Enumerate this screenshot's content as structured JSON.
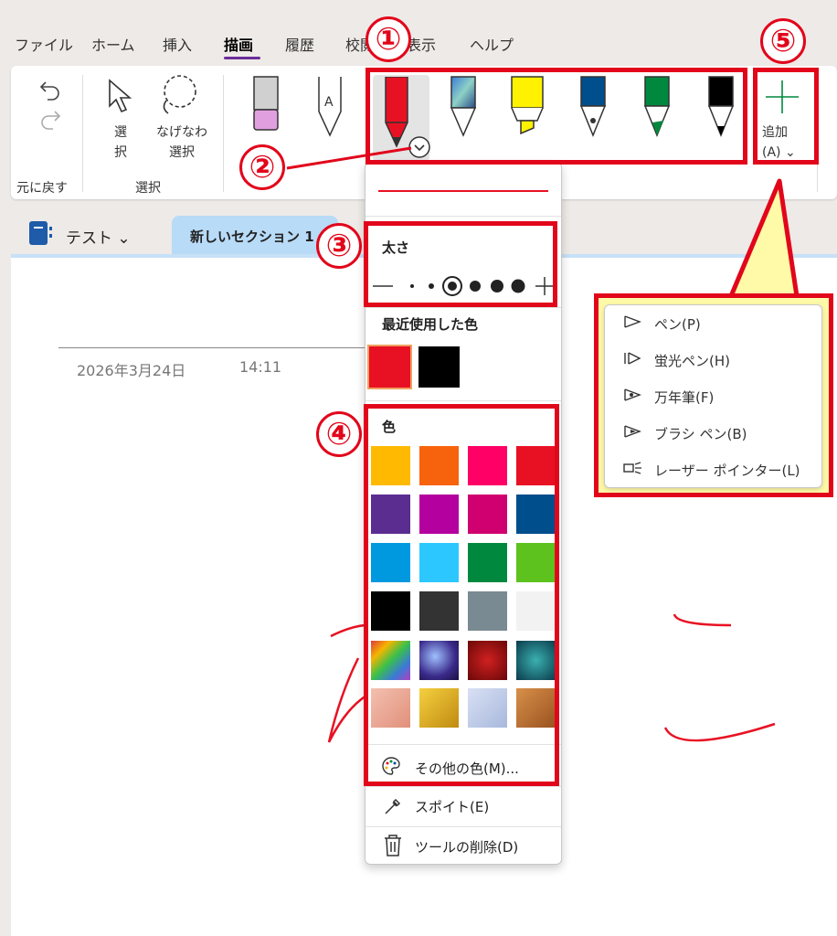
{
  "menu": {
    "items": [
      "ファイル",
      "ホーム",
      "挿入",
      "描画",
      "履歴",
      "校閲",
      "表示",
      "ヘルプ"
    ],
    "active": "描画"
  },
  "ribbon": {
    "undo_group_label": "元に戻す",
    "select_label": "選択",
    "select_button": "選\n択",
    "lasso_button": "なげなわ\n選択",
    "add_label": "追加",
    "add_shortcut": "(A)"
  },
  "notebook": {
    "name": "テスト",
    "section_tab": "新しいセクション 1"
  },
  "page": {
    "date": "2026年3月24日",
    "time": "14:11"
  },
  "flyout": {
    "thickness_label": "太さ",
    "recent_colors_label": "最近使用した色",
    "recent_colors": [
      "#e81123",
      "#000000"
    ],
    "colors_label": "色",
    "colors": [
      "#ffb900",
      "#f7630c",
      "#ff0066",
      "#e81123",
      "#5c2d91",
      "#b4009e",
      "#d00070",
      "#004e8c",
      "#0099e0",
      "#2dc7ff",
      "#00893e",
      "#5dc21e",
      "#000000",
      "#333333",
      "#7a8a92",
      "#f2f2f2"
    ],
    "more_colors": "その他の色(M)...",
    "eyedropper": "スポイト(E)",
    "delete_tool": "ツールの削除(D)"
  },
  "add_menu": {
    "items": [
      "ペン(P)",
      "蛍光ペン(H)",
      "万年筆(F)",
      "ブラシ ペン(B)",
      "レーザー ポインター(L)"
    ]
  },
  "callouts": [
    "①",
    "②",
    "③",
    "④",
    "⑤"
  ],
  "colors": {
    "accent_red": "#e2061b",
    "brand_purple": "#6b2d9a",
    "section_blue": "#b8dbf7"
  }
}
